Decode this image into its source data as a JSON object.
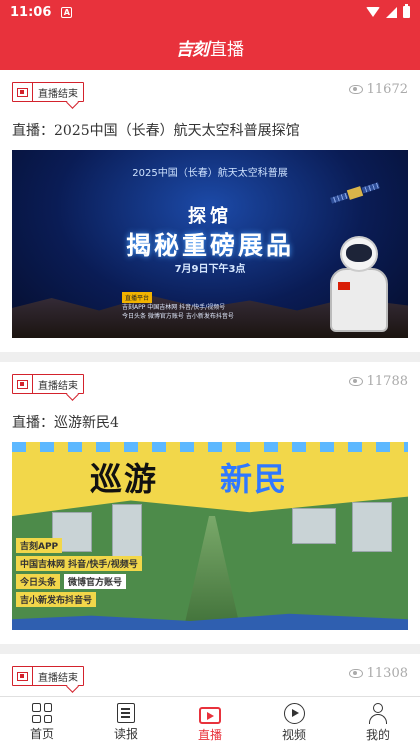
{
  "status_bar": {
    "time": "11:06",
    "a_icon": "A"
  },
  "header": {
    "logo": "吉刻",
    "title": "直播"
  },
  "feed": [
    {
      "badge": "直播结束",
      "views": "11672",
      "title": "直播：2025中国（长春）航天太空科普展探馆",
      "thumbnail": {
        "subtitle": "2025中国（长春）航天太空科普展",
        "line1": "探馆",
        "line2": "揭秘重磅展品",
        "date": "7月9日下午3点",
        "tag": "直播平台",
        "info1": "吉刻APP   中国吉林网 抖音/快手/视频号",
        "info2": "今日头条  微博官方账号  吉小新发布抖音号"
      }
    },
    {
      "badge": "直播结束",
      "views": "11788",
      "title": "直播：巡游新民4",
      "thumbnail": {
        "title_a": "巡游",
        "title_b": "新民",
        "labels": [
          "吉刻APP",
          "中国吉林网 抖音/快手/视频号",
          "今日头条",
          "微博官方账号",
          "吉小新发布抖音号"
        ]
      }
    },
    {
      "badge": "直播结束",
      "views": "11308"
    }
  ],
  "bottom_nav": [
    {
      "label": "首页",
      "icon": "home-grid-icon"
    },
    {
      "label": "读报",
      "icon": "newspaper-icon"
    },
    {
      "label": "直播",
      "icon": "live-tv-icon",
      "active": true
    },
    {
      "label": "视频",
      "icon": "play-circle-icon"
    },
    {
      "label": "我的",
      "icon": "user-icon"
    }
  ],
  "colors": {
    "brand_red": "#e8323c",
    "badge_red": "#d3222c",
    "muted": "#aaaaaa"
  }
}
